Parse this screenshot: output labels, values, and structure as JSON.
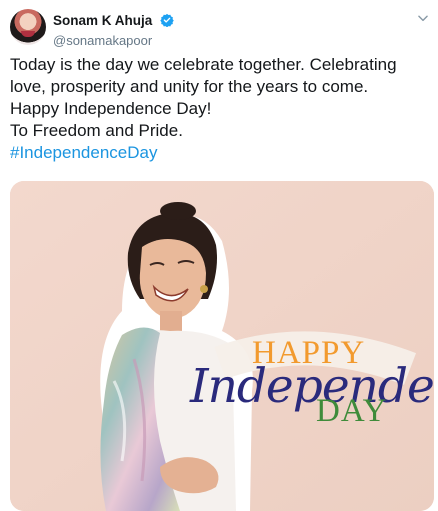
{
  "user": {
    "display_name": "Sonam K Ahuja",
    "handle": "@sonamakapoor",
    "verified": true
  },
  "tweet": {
    "text": "Today is the day we celebrate together. Celebrating love, prosperity and unity for the years to come.\nHappy Independence Day!\nTo Freedom and Pride.",
    "hashtag": "#IndependenceDay"
  },
  "media": {
    "overlay_happy": "HAPPY",
    "overlay_independence": "Independence",
    "overlay_day": "DAY"
  },
  "colors": {
    "hashtag": "#1b95e0",
    "verified": "#1da1f2",
    "saffron": "#f29a2e",
    "navy": "#2a2a7c",
    "green": "#3f8b3a"
  },
  "icons": [
    "verified-badge-icon",
    "chevron-down-icon"
  ]
}
